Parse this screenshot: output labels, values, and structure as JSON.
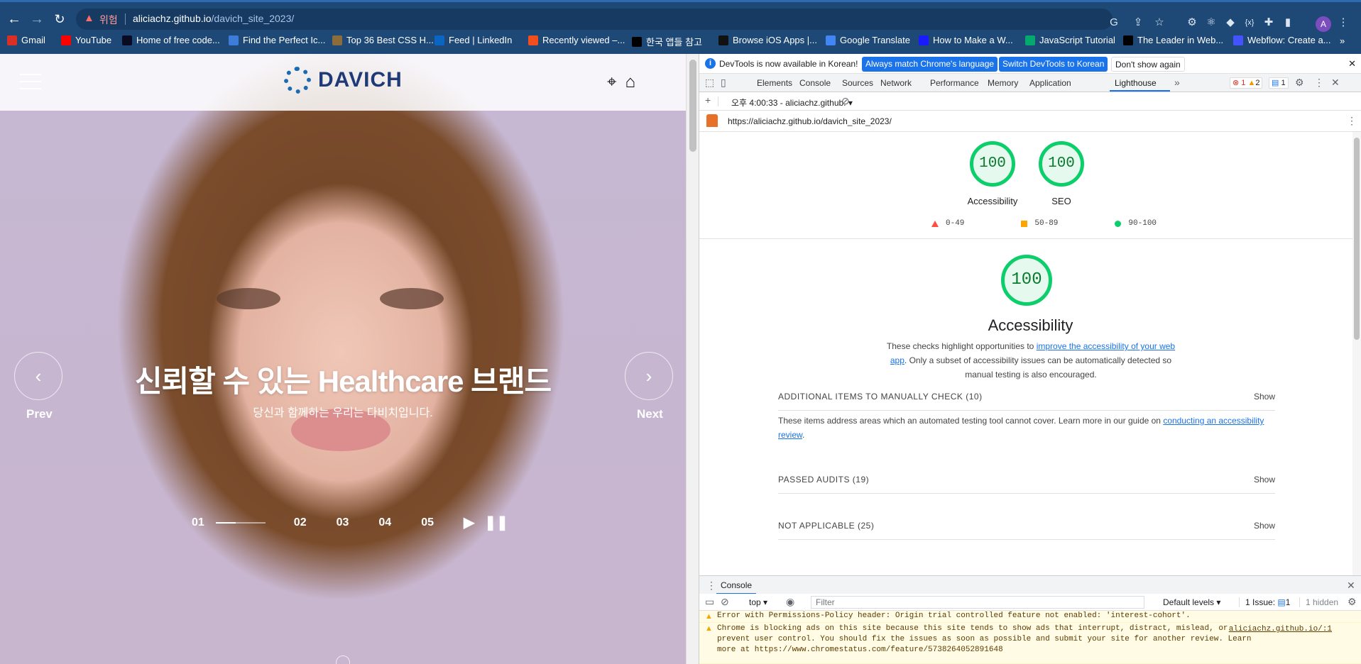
{
  "browser": {
    "warning_label": "위험",
    "url_host": "aliciachz.github.io",
    "url_path": "/davich_site_2023/",
    "avatar_letter": "A",
    "bookmarks": [
      {
        "label": "Gmail",
        "icon": "gmail-icon",
        "color": "#d93025"
      },
      {
        "label": "YouTube",
        "icon": "youtube-icon",
        "color": "#ff0000"
      },
      {
        "label": "Home of free code...",
        "icon": "freecodecamp-icon",
        "color": "#0a0a23"
      },
      {
        "label": "Find the Perfect Ic...",
        "icon": "flaticon-icon",
        "color": "#3c7dd9"
      },
      {
        "label": "Top 36 Best CSS H...",
        "icon": "page-icon",
        "color": "#8a6d3b"
      },
      {
        "label": "Feed | LinkedIn",
        "icon": "linkedin-icon",
        "color": "#0a66c2"
      },
      {
        "label": "Recently viewed –...",
        "icon": "figma-icon",
        "color": "#f24e1e"
      },
      {
        "label": "한국 앱들 참고",
        "icon": "w-icon",
        "color": "#000000"
      },
      {
        "label": "Browse iOS Apps |...",
        "icon": "mobbin-icon",
        "color": "#111111"
      },
      {
        "label": "Google Translate",
        "icon": "translate-icon",
        "color": "#4285f4"
      },
      {
        "label": "How to Make a W...",
        "icon": "bookmark-icon",
        "color": "#1a1aff"
      },
      {
        "label": "JavaScript Tutorial",
        "icon": "w3schools-icon",
        "color": "#04aa6d"
      },
      {
        "label": "The Leader in Web...",
        "icon": "wix-icon",
        "color": "#000000"
      },
      {
        "label": "Webflow: Create a...",
        "icon": "webflow-icon",
        "color": "#4353ff"
      }
    ]
  },
  "site": {
    "logo_text": "DAVICH",
    "hero_title": "신뢰할 수 있는 Healthcare 브랜드",
    "hero_subtitle": "당신과 함께하는 우리는 다비치입니다.",
    "prev_label": "Prev",
    "next_label": "Next",
    "slides": [
      "01",
      "02",
      "03",
      "04",
      "05"
    ],
    "slide_progress": 0.4
  },
  "devtools": {
    "info_message": "DevTools is now available in Korean!",
    "btn_match": "Always match Chrome's language",
    "btn_switch": "Switch DevTools to Korean",
    "btn_dont": "Don't show again",
    "tabs": [
      "Elements",
      "Console",
      "Sources",
      "Network",
      "Performance",
      "Memory",
      "Application",
      "Lighthouse"
    ],
    "active_tab": "Lighthouse",
    "errors": "1",
    "warnings": "2",
    "issues": "1",
    "report_time": "오후 4:00:33 - aliciachz.github.",
    "report_url": "https://aliciachz.github.io/davich_site_2023/",
    "scores": [
      {
        "value": "100",
        "label": "Accessibility"
      },
      {
        "value": "100",
        "label": "SEO"
      }
    ],
    "legend": [
      "0-49",
      "50-89",
      "90-100"
    ],
    "category_score": "100",
    "category_title": "Accessibility",
    "desc_pre": "These checks highlight opportunities to ",
    "desc_link": "improve the accessibility of your web app",
    "desc_post": ". Only a subset of accessibility issues can be automatically detected so manual testing is also encouraged.",
    "section_manual": "ADDITIONAL ITEMS TO MANUALLY CHECK (10)",
    "manual_text_pre": "These items address areas which an automated testing tool cannot cover. Learn more in our guide on ",
    "manual_link": "conducting an accessibility review",
    "manual_text_post": ".",
    "section_passed": "PASSED AUDITS (19)",
    "section_na": "NOT APPLICABLE (25)",
    "show_label": "Show"
  },
  "console": {
    "tab_label": "Console",
    "context": "top",
    "filter_placeholder": "Filter",
    "levels": "Default levels",
    "issues": "1 Issue:",
    "issues_count": "1",
    "hidden": "1 hidden",
    "messages": [
      {
        "text": "Error with Permissions-Policy header: Origin trial controlled feature not enabled: 'interest-cohort'.",
        "source": ""
      },
      {
        "text": "Chrome is blocking ads on this site because this site tends to show ads that interrupt, distract, mislead, or prevent user control. You should fix the issues as soon as possible and submit your site for another review. Learn more at https://www.chromestatus.com/feature/5738264052891648",
        "source": "aliciachz.github.io/:1"
      }
    ]
  }
}
